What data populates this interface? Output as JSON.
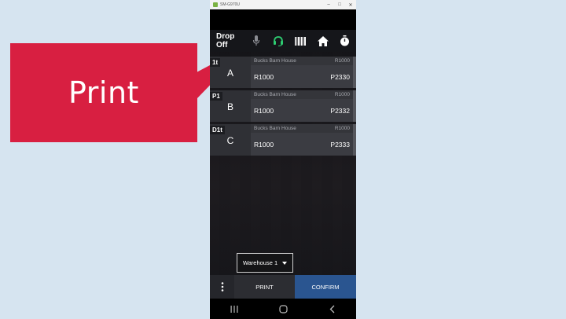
{
  "callout": {
    "label": "Print",
    "color": "#d81f41"
  },
  "window": {
    "title": "SM-G970U"
  },
  "toolbar": {
    "title": "Drop Off",
    "icons": [
      "microphone-icon",
      "headset-icon",
      "barcode-icon",
      "home-icon",
      "stopwatch-icon"
    ],
    "headset_color": "#2ecc71"
  },
  "items": [
    {
      "tag": "1t",
      "letter": "A",
      "company": "Bucks Barn House",
      "ref": "R1000",
      "left_value": "R1000",
      "right_value": "P2330"
    },
    {
      "tag": "P1",
      "letter": "B",
      "company": "Bucks Barn House",
      "ref": "R1000",
      "left_value": "R1000",
      "right_value": "P2332"
    },
    {
      "tag": "D1t",
      "letter": "C",
      "company": "Bucks Barn House",
      "ref": "R1000",
      "left_value": "R1000",
      "right_value": "P2333"
    }
  ],
  "warehouse_select": {
    "value": "Warehouse 1"
  },
  "bottombar": {
    "print_label": "PRINT",
    "confirm_label": "CONFIRM",
    "confirm_color": "#2a5590"
  },
  "navbar": {
    "icons": [
      "recent-apps-icon",
      "home-circle-icon",
      "back-icon"
    ]
  }
}
